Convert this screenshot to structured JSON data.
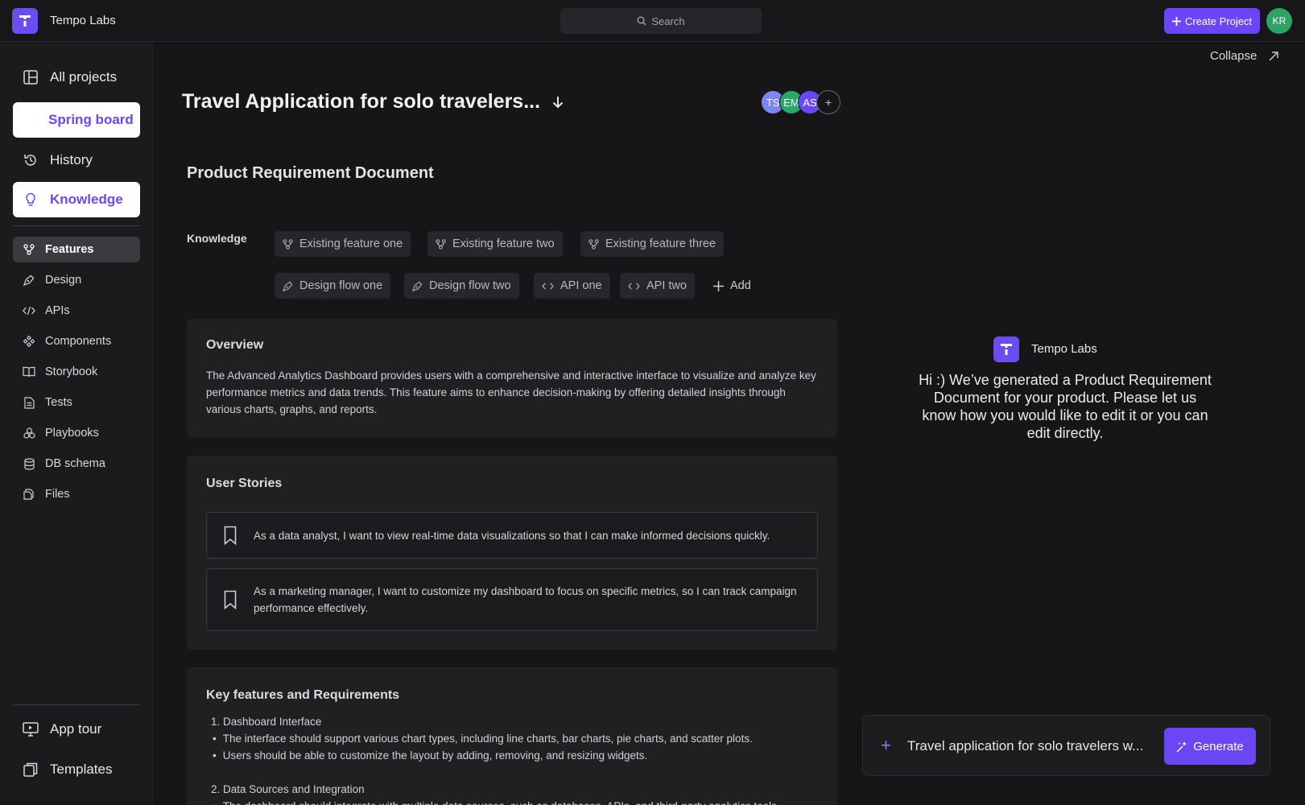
{
  "app": {
    "name": "Tempo Labs",
    "logo_glyph": "T"
  },
  "topbar": {
    "search_label": "Search",
    "create_label": "Create Project",
    "user_initials": "KR"
  },
  "sidebar": {
    "primary": [
      {
        "label": "All projects",
        "icon": "layout-icon"
      },
      {
        "label": "Spring board",
        "icon": "none"
      },
      {
        "label": "History",
        "icon": "history-icon"
      },
      {
        "label": "Knowledge",
        "icon": "lightbulb-icon"
      }
    ],
    "sections": [
      {
        "label": "Features",
        "icon": "features-icon"
      },
      {
        "label": "Design",
        "icon": "pen-icon"
      },
      {
        "label": "APIs",
        "icon": "code-icon"
      },
      {
        "label": "Components",
        "icon": "components-icon"
      },
      {
        "label": "Storybook",
        "icon": "book-icon"
      },
      {
        "label": "Tests",
        "icon": "file-icon"
      },
      {
        "label": "Playbooks",
        "icon": "playbooks-icon"
      },
      {
        "label": "DB schema",
        "icon": "database-icon"
      },
      {
        "label": "Files",
        "icon": "files-icon"
      }
    ],
    "footer": [
      {
        "label": "App tour",
        "icon": "monitor-icon"
      },
      {
        "label": "Templates",
        "icon": "templates-icon"
      }
    ]
  },
  "main": {
    "collapse_label": "Collapse",
    "project_title": "Travel Application for solo travelers...",
    "collaborators": [
      {
        "initials": "TS",
        "color": "#7b86f0"
      },
      {
        "initials": "EM",
        "color": "#2aa86a"
      },
      {
        "initials": "AS",
        "color": "#6b46f5"
      }
    ],
    "doc_title": "Product Requirement Document",
    "knowledge": {
      "label": "Knowledge",
      "chips": [
        {
          "label": "Existing feature one",
          "icon": "features-icon"
        },
        {
          "label": "Existing feature two",
          "icon": "features-icon"
        },
        {
          "label": "Existing feature three",
          "icon": "features-icon"
        },
        {
          "label": "Design flow one",
          "icon": "pen-icon"
        },
        {
          "label": "Design flow two",
          "icon": "pen-icon"
        },
        {
          "label": "API one",
          "icon": "code-icon"
        },
        {
          "label": "API two",
          "icon": "code-icon"
        }
      ],
      "add_label": "Add"
    },
    "overview": {
      "heading": "Overview",
      "text": "The Advanced Analytics Dashboard provides users with a comprehensive and interactive interface to visualize and analyze key performance metrics and data trends. This feature aims to enhance decision-making by offering detailed insights through various charts, graphs, and reports."
    },
    "user_stories": {
      "heading": "User Stories",
      "items": [
        "As a data analyst, I want to view real-time data visualizations so that I can make informed decisions quickly.",
        "As a marketing manager, I want to customize my dashboard to focus on specific metrics, so I can track campaign performance effectively."
      ]
    },
    "key_features": {
      "heading": "Key features and Requirements",
      "sections": [
        {
          "title": "1. Dashboard Interface",
          "bullets": [
            "The interface should support various chart types, including line charts, bar charts, pie charts, and scatter plots.",
            "Users should be able to customize the layout by adding, removing, and resizing widgets."
          ]
        },
        {
          "title": "2. Data Sources and Integration",
          "bullets": [
            "The dashboard should integrate with multiple data sources, such as databases, APIs, and third-party analytics tools."
          ]
        }
      ]
    }
  },
  "chat": {
    "brand": "Tempo Labs",
    "message": "Hi :) We’ve generated a Product Requirement Document for your product. Please let us know how you would like to edit it or you can edit directly.",
    "input_value": "Travel application for solo travelers w...",
    "generate_label": "Generate"
  }
}
